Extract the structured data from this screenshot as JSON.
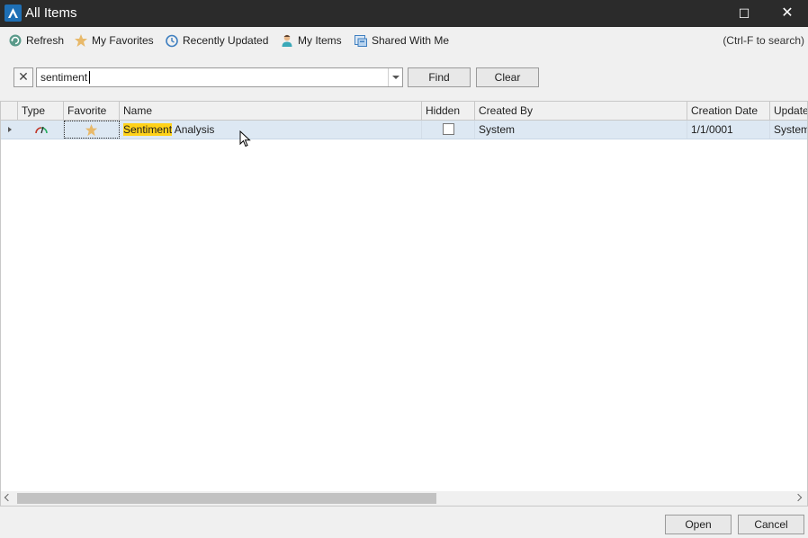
{
  "window": {
    "title": "All Items",
    "maximize_glyph": "☐",
    "close_glyph": "✕"
  },
  "toolbar": {
    "items": [
      {
        "label": "Refresh",
        "icon": "refresh-icon"
      },
      {
        "label": "My Favorites",
        "icon": "star-icon"
      },
      {
        "label": "Recently Updated",
        "icon": "clock-icon"
      },
      {
        "label": "My Items",
        "icon": "user-icon"
      },
      {
        "label": "Shared With Me",
        "icon": "shared-icon"
      }
    ],
    "shortcut_hint": "(Ctrl-F to search)"
  },
  "search": {
    "clear_glyph": "✕",
    "value": "sentiment",
    "find_label": "Find",
    "clear_label": "Clear"
  },
  "grid": {
    "columns": [
      "Type",
      "Favorite",
      "Name",
      "Hidden",
      "Created By",
      "Creation Date",
      "Update"
    ],
    "rows": [
      {
        "type_icon": "gauge-icon",
        "favorite": true,
        "name_match": "Sentiment",
        "name_rest": " Analysis",
        "hidden": false,
        "created_by": "System",
        "creation_date": "1/1/0001",
        "updated_by": "System"
      }
    ]
  },
  "footer": {
    "open_label": "Open",
    "cancel_label": "Cancel"
  },
  "colors": {
    "titlebar": "#2b2b2b",
    "selection": "#dde8f3",
    "highlight": "#ffd21a",
    "accent": "#1e6fb5"
  }
}
